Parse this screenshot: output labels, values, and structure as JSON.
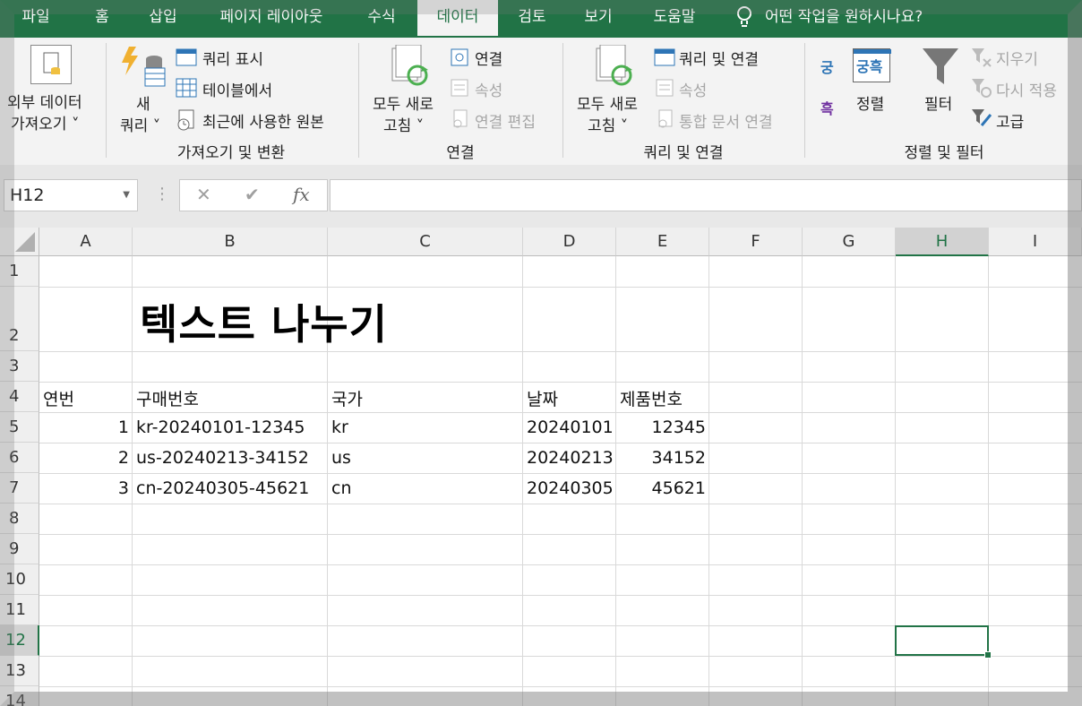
{
  "tabs": [
    "파일",
    "홈",
    "삽입",
    "페이지 레이아웃",
    "수식",
    "데이터",
    "검토",
    "보기",
    "도움말"
  ],
  "active_tab": "데이터",
  "tell_me": "어떤 작업을 원하시나요?",
  "ribbon": {
    "get_external": [
      "외부 데이터",
      "가져오기 ˅"
    ],
    "new_query": [
      "새",
      "쿼리 ˅"
    ],
    "show_queries": "쿼리 표시",
    "from_table": "테이블에서",
    "recent_sources": "최근에 사용한 원본",
    "group_get_transform": "가져오기 및 변환",
    "refresh_all_1": [
      "모두 새로",
      "고침 ˅"
    ],
    "connections": "연결",
    "properties_1": "속성",
    "edit_links": "연결 편집",
    "group_connections": "연결",
    "refresh_all_2": [
      "모두 새로",
      "고침 ˅"
    ],
    "queries_connections": "쿼리 및 연결",
    "properties_2": "속성",
    "edit_links_2": "통합 문서 연결",
    "group_queries": "쿼리 및 연결",
    "sort_az": "궁",
    "sort_za": "흑",
    "sort_icon": "궁흑",
    "sort": "정렬",
    "filter": "필터",
    "clear": "지우기",
    "reapply": "다시 적용",
    "advanced": "고급",
    "group_sort_filter": "정렬 및 필터"
  },
  "formula_bar": {
    "name_box": "H12",
    "dots": "⋮",
    "cancel": "✕",
    "enter": "✔",
    "fx": "fx",
    "formula": ""
  },
  "columns": [
    "A",
    "B",
    "C",
    "D",
    "E",
    "F",
    "G",
    "H",
    "I"
  ],
  "selected_column": "H",
  "rows": [
    "1",
    "2",
    "3",
    "4",
    "5",
    "6",
    "7",
    "8",
    "9",
    "10",
    "11",
    "12",
    "13",
    "14"
  ],
  "selected_row": "12",
  "sheet": {
    "title": "텍스트 나누기",
    "headers": [
      "연번",
      "구매번호",
      "국가",
      "날짜",
      "제품번호"
    ],
    "data": [
      [
        "1",
        "kr-20240101-12345",
        "kr",
        "20240101",
        "12345"
      ],
      [
        "2",
        "us-20240213-34152",
        "us",
        "20240213",
        "34152"
      ],
      [
        "3",
        "cn-20240305-45621",
        "cn",
        "20240305",
        "45621"
      ]
    ]
  },
  "colors": {
    "accent": "#217346",
    "ribbon_bg": "#f3f3f3"
  }
}
